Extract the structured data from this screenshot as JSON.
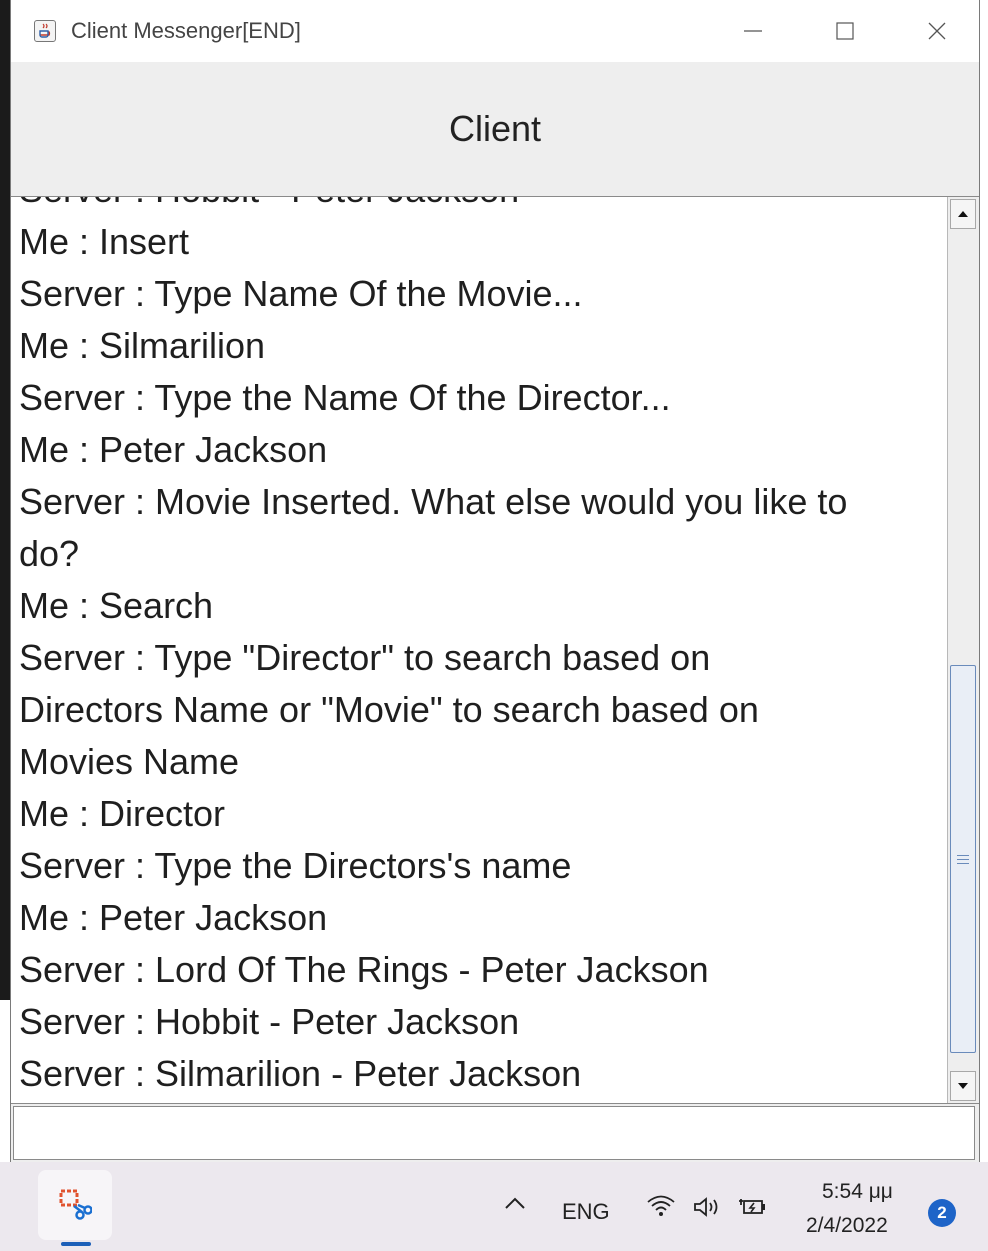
{
  "window": {
    "title": "Client Messenger[END]",
    "header": "Client"
  },
  "chat": {
    "lines": [
      "Server : Hobbit - Peter Jackson",
      "Me : Insert",
      "Server : Type Name Of the Movie...",
      "Me : Silmarilion",
      "Server : Type the Name Of the Director...",
      "Me : Peter Jackson",
      "Server : Movie Inserted. What else would you like to",
      "do?",
      "Me : Search",
      "Server : Type \"Director\" to search based on",
      "Directors Name or \"Movie\" to search based on",
      "Movies Name",
      "Me : Director",
      "Server : Type the Directors's name",
      "Me : Peter Jackson",
      "Server : Lord Of The Rings - Peter Jackson",
      "Server : Hobbit - Peter Jackson",
      "Server : Silmarilion - Peter Jackson"
    ],
    "scroll_position": 1.0
  },
  "input": {
    "value": ""
  },
  "taskbar": {
    "language": "ENG",
    "time": "5:54 μμ",
    "date": "2/4/2022",
    "notification_count": "2",
    "accent_color": "#1e64c8"
  },
  "icons": {
    "app": "java-coffee-icon",
    "taskbar_app": "snipping-tool-icon",
    "tray": [
      "chevron-up-icon",
      "wifi-icon",
      "volume-icon",
      "battery-charging-icon"
    ]
  }
}
